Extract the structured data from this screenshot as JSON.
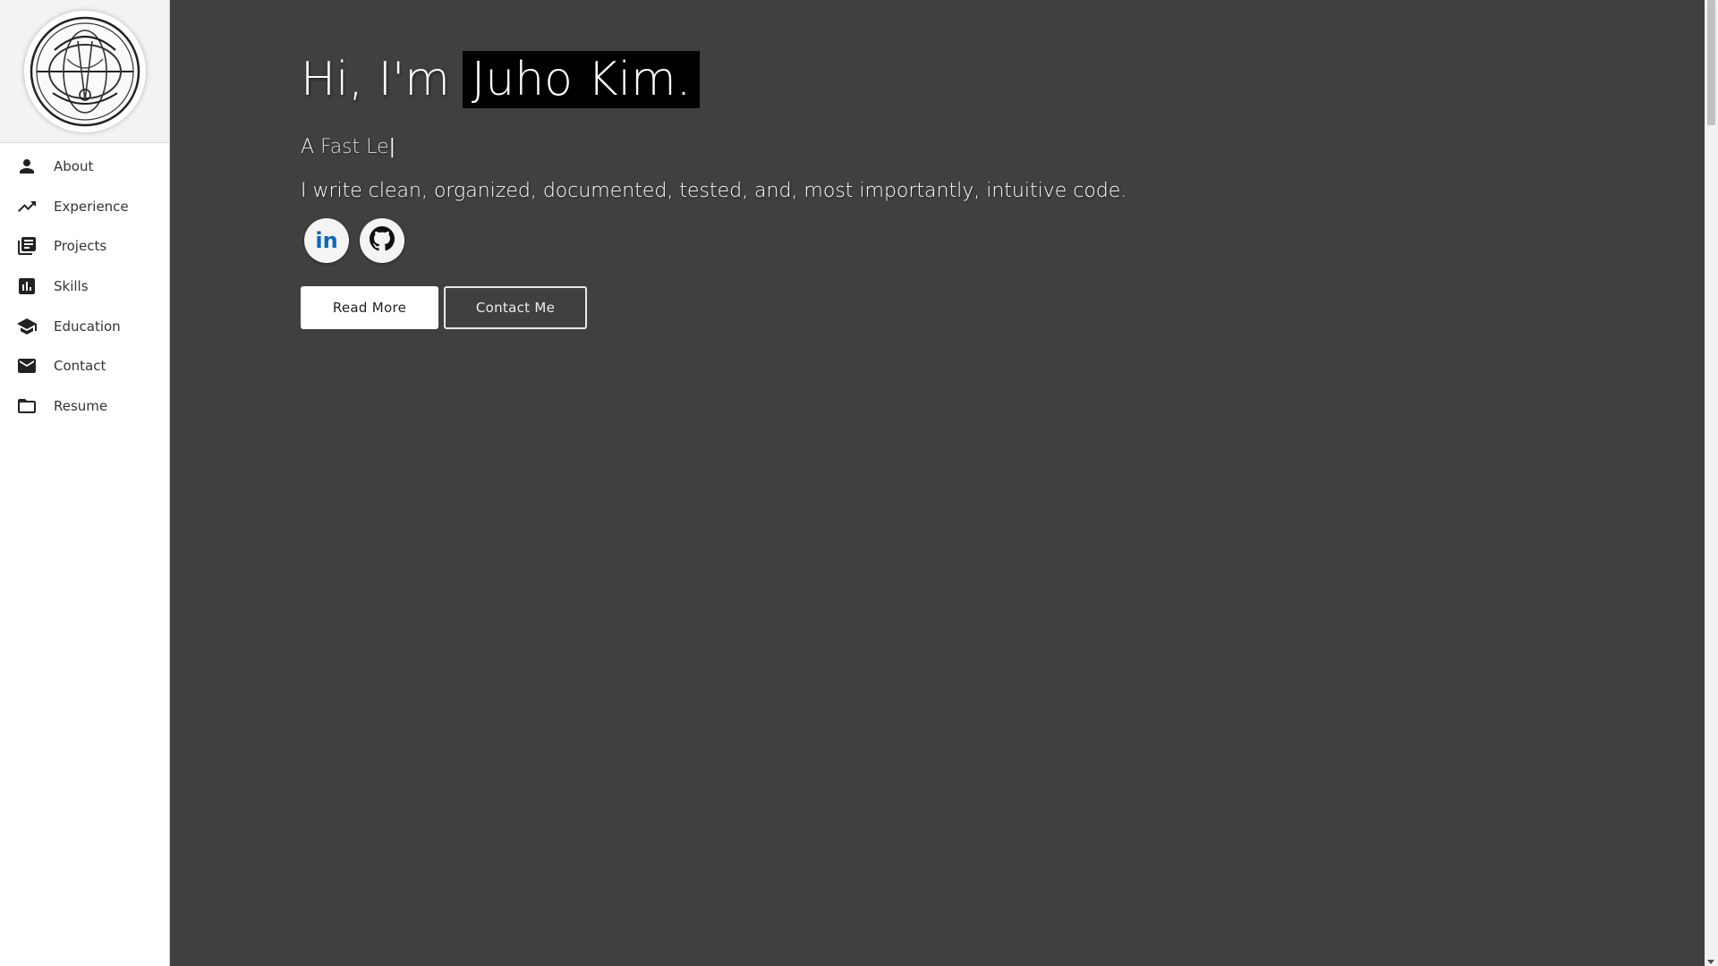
{
  "sidebar": {
    "items": [
      {
        "label": "About",
        "icon": "person-icon"
      },
      {
        "label": "Experience",
        "icon": "trending-up-icon"
      },
      {
        "label": "Projects",
        "icon": "library-books-icon"
      },
      {
        "label": "Skills",
        "icon": "bar-chart-icon"
      },
      {
        "label": "Education",
        "icon": "school-icon"
      },
      {
        "label": "Contact",
        "icon": "mail-icon"
      },
      {
        "label": "Resume",
        "icon": "folder-icon"
      }
    ]
  },
  "hero": {
    "greeting": "Hi, I'm",
    "name": "Juho Kim.",
    "subtitle_prefix": "A",
    "subtitle_typed": "Fast Le",
    "subtitle_caret": "|",
    "tagline": "I write clean, organized, documented, tested, and, most importantly, intuitive code."
  },
  "socials": [
    {
      "name": "linkedin-icon",
      "label": "in"
    },
    {
      "name": "github-icon"
    }
  ],
  "buttons": {
    "read_more": "Read More",
    "contact_me": "Contact Me"
  },
  "colors": {
    "background": "#404040",
    "sidebar": "#ffffff",
    "linkedin": "#0a66c2"
  }
}
